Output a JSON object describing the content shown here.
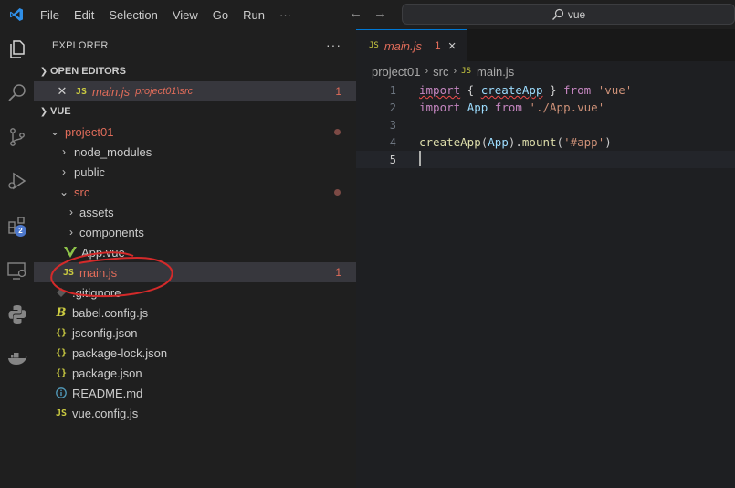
{
  "menu": [
    "File",
    "Edit",
    "Selection",
    "View",
    "Go",
    "Run",
    "···"
  ],
  "search": {
    "text": "vue"
  },
  "activity": {
    "extensions_badge": "2"
  },
  "explorer": {
    "title": "EXPLORER",
    "more": "···",
    "open_editors": {
      "header": "OPEN EDITORS",
      "items": [
        {
          "icon": "JS",
          "name": "main.js",
          "path": "project01\\src",
          "problems": "1"
        }
      ]
    },
    "workspace": {
      "header": "VUE",
      "tree": [
        {
          "label": "project01",
          "kind": "folder-open",
          "level": 1,
          "modified": true
        },
        {
          "label": "node_modules",
          "kind": "folder",
          "level": 2
        },
        {
          "label": "public",
          "kind": "folder",
          "level": 2
        },
        {
          "label": "src",
          "kind": "folder-open",
          "level": 2,
          "modified": true
        },
        {
          "label": "assets",
          "kind": "folder",
          "level": 3
        },
        {
          "label": "components",
          "kind": "folder",
          "level": 3
        },
        {
          "label": "App.vue",
          "kind": "vue",
          "level": 3
        },
        {
          "label": "main.js",
          "kind": "js",
          "level": 3,
          "problems": "1",
          "selected": true
        },
        {
          "label": ".gitignore",
          "kind": "git",
          "level": 2
        },
        {
          "label": "babel.config.js",
          "kind": "babel",
          "level": 2
        },
        {
          "label": "jsconfig.json",
          "kind": "json",
          "level": 2
        },
        {
          "label": "package-lock.json",
          "kind": "json",
          "level": 2
        },
        {
          "label": "package.json",
          "kind": "json",
          "level": 2
        },
        {
          "label": "README.md",
          "kind": "info",
          "level": 2
        },
        {
          "label": "vue.config.js",
          "kind": "js",
          "level": 2
        }
      ]
    }
  },
  "editor": {
    "tab": {
      "icon": "JS",
      "name": "main.js",
      "problems": "1",
      "close": "×"
    },
    "breadcrumb": [
      "project01",
      "src",
      "main.js"
    ],
    "breadcrumb_icon": "JS",
    "lines": [
      {
        "n": "1",
        "tokens": [
          [
            "kw squig",
            "import"
          ],
          [
            "pu",
            " { "
          ],
          [
            "vr squig",
            "createApp"
          ],
          [
            "pu",
            " } "
          ],
          [
            "kw",
            "from"
          ],
          [
            "pu",
            " "
          ],
          [
            "str",
            "'vue'"
          ]
        ]
      },
      {
        "n": "2",
        "tokens": [
          [
            "kw",
            "import"
          ],
          [
            "pu",
            " "
          ],
          [
            "vr",
            "App"
          ],
          [
            "pu",
            " "
          ],
          [
            "kw",
            "from"
          ],
          [
            "pu",
            " "
          ],
          [
            "str",
            "'./App.vue'"
          ]
        ]
      },
      {
        "n": "3",
        "tokens": []
      },
      {
        "n": "4",
        "tokens": [
          [
            "fn",
            "createApp"
          ],
          [
            "pu",
            "("
          ],
          [
            "vr",
            "App"
          ],
          [
            "pu",
            ")."
          ],
          [
            "fn",
            "mount"
          ],
          [
            "pu",
            "("
          ],
          [
            "str",
            "'#app'"
          ],
          [
            "pu",
            ")"
          ]
        ]
      },
      {
        "n": "5",
        "tokens": [],
        "cursor": true
      }
    ]
  }
}
